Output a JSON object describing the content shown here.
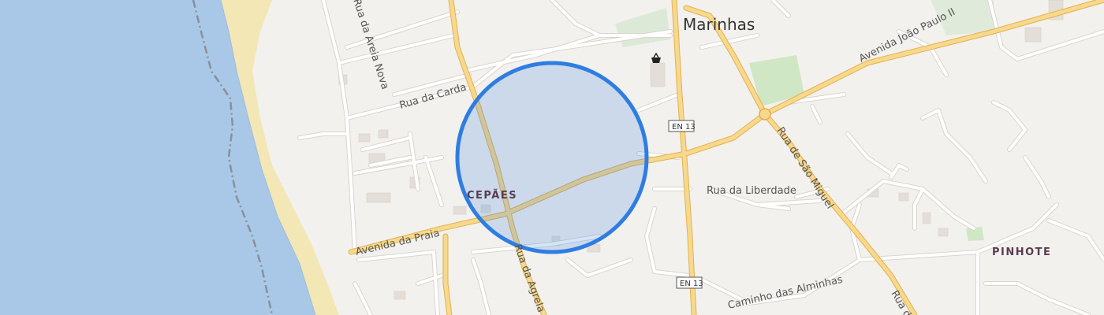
{
  "map": {
    "colors": {
      "water": "#a9c8e8",
      "beach": "#f2e7b5",
      "land": "#f3f1ee",
      "major_road": "#f4cf7a",
      "major_road_casing": "#e3b04f",
      "minor_road": "#ffffff",
      "minor_road_casing": "#d9d5cf",
      "park": "#cfe7c4",
      "circle_stroke": "#2f7de1",
      "circle_fill": "#2f7de1"
    },
    "selection_circle": {
      "shape": "circle"
    },
    "places": {
      "marinhas": "Marinhas",
      "cepaes": "CEPÃES",
      "pinhote": "PINHOTE"
    },
    "streets": {
      "rua_da_areia_nova": "Rua da Areia Nova",
      "rua_da_carda": "Rua da Carda",
      "avenida_joao_paulo_ii": "Avenida João Paulo II",
      "rua_de_sao_miguel": "Rua de São Miguel",
      "rua_da_liberdade": "Rua da Liberdade",
      "avenida_da_praia": "Avenida da Praia",
      "rua_da_agrela": "Rua da Agrela",
      "caminho_das_alminhas": "Caminho das Alminhas",
      "rua_dr": "Rua dr"
    },
    "road_shields": {
      "en13_north": "EN 13",
      "en13_south": "EN 13"
    },
    "icons": {
      "shop": "shop-basket-icon"
    }
  }
}
